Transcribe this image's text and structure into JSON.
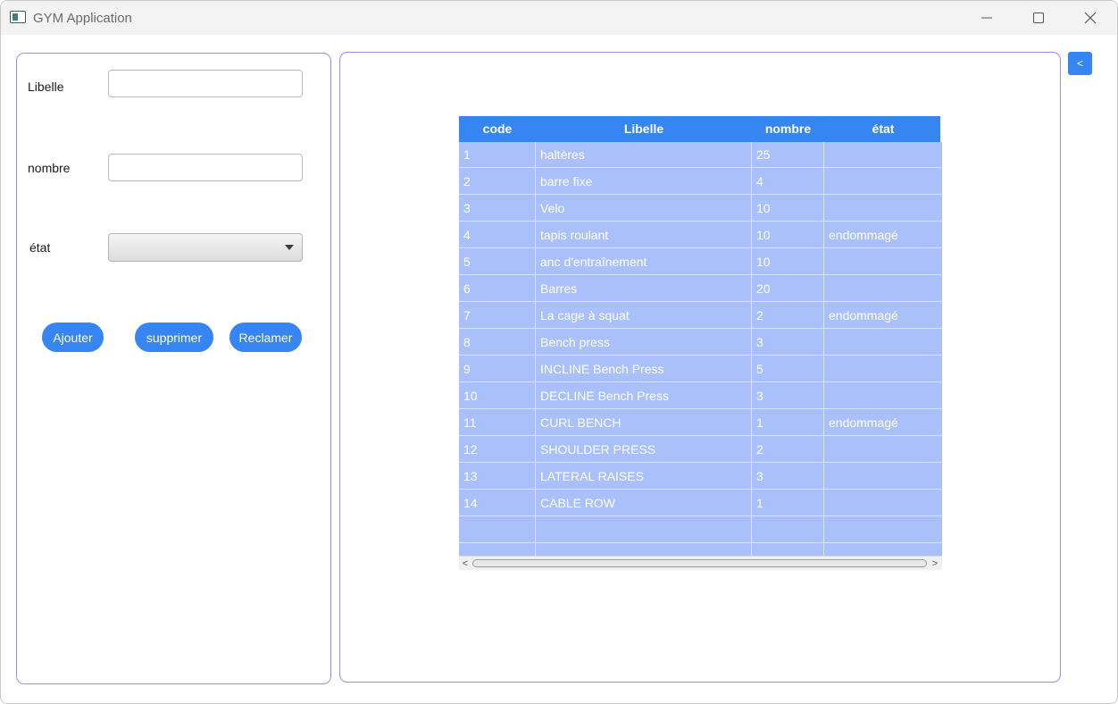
{
  "window": {
    "title": "GYM Application",
    "controls": {
      "minimize": "minimize-icon",
      "maximize": "maximize-icon",
      "close": "close-icon"
    }
  },
  "form": {
    "libelle_label": "Libelle",
    "libelle_value": "",
    "nombre_label": "nombre",
    "nombre_value": "",
    "etat_label": "état",
    "etat_selected": "",
    "buttons": {
      "ajouter": "Ajouter",
      "supprimer": "supprimer",
      "reclamer": "Reclamer"
    }
  },
  "back_button": "<",
  "table": {
    "columns": [
      "code",
      "Libelle",
      "nombre",
      "état"
    ],
    "rows": [
      [
        "1",
        "haltères",
        "25",
        ""
      ],
      [
        "2",
        "barre fixe",
        "4",
        ""
      ],
      [
        "3",
        "Velo",
        "10",
        ""
      ],
      [
        "4",
        "tapis roulant",
        "10",
        "endommagé"
      ],
      [
        "5",
        "anc d'entraînement",
        "10",
        ""
      ],
      [
        "6",
        "Barres",
        "20",
        ""
      ],
      [
        "7",
        "La cage à squat",
        "2",
        "endommagé"
      ],
      [
        "8",
        "Bench press",
        "3",
        ""
      ],
      [
        "9",
        "INCLINE Bench Press",
        "5",
        ""
      ],
      [
        "10",
        "DECLINE Bench Press",
        "3",
        ""
      ],
      [
        "11",
        "CURL BENCH",
        "1",
        "endommagé"
      ],
      [
        "12",
        "SHOULDER PRESS",
        "2",
        ""
      ],
      [
        "13",
        "LATERAL RAISES",
        "3",
        ""
      ],
      [
        "14",
        "CABLE ROW",
        "1",
        ""
      ],
      [
        "",
        "",
        "",
        ""
      ],
      [
        "",
        "",
        "",
        ""
      ]
    ],
    "scroll_left": "<",
    "scroll_right": ">"
  },
  "colors": {
    "accent": "#3586f2",
    "panel_border": "#9b8fe0",
    "row_bg": "#aac0fb"
  }
}
